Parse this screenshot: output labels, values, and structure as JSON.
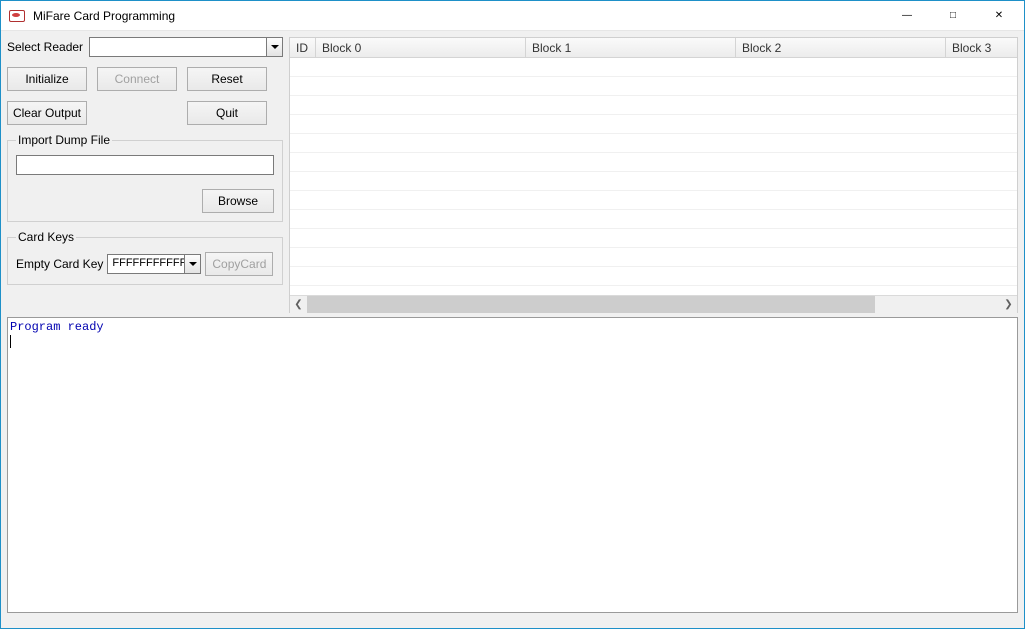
{
  "window": {
    "title": "MiFare Card Programming"
  },
  "reader": {
    "label": "Select Reader",
    "value": ""
  },
  "buttons": {
    "initialize": "Initialize",
    "connect": "Connect",
    "reset": "Reset",
    "clear_output": "Clear Output",
    "quit": "Quit",
    "browse": "Browse",
    "copycard": "CopyCard"
  },
  "import_group": {
    "legend": "Import Dump File",
    "path": ""
  },
  "keys_group": {
    "legend": "Card Keys",
    "empty_key_label": "Empty Card Key",
    "empty_key_value": "FFFFFFFFFFFF"
  },
  "grid": {
    "columns": [
      "ID",
      "Block 0",
      "Block 1",
      "Block 2",
      "Block 3"
    ],
    "rows": []
  },
  "output": {
    "text": "Program ready"
  }
}
